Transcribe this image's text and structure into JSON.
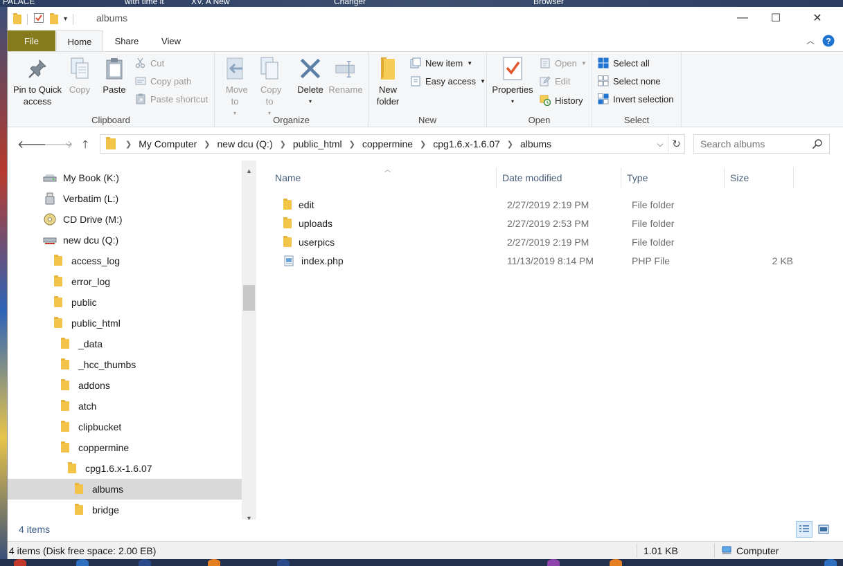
{
  "desktop": {
    "top_labels": [
      "PALACE",
      "with time it",
      "XV. A New",
      "Changer",
      "Browser"
    ]
  },
  "window": {
    "title": "albums",
    "controls": {
      "minimize": "—",
      "maximize": "☐",
      "close": "✕"
    }
  },
  "ribbon_tabs": {
    "file": "File",
    "home": "Home",
    "share": "Share",
    "view": "View"
  },
  "ribbon": {
    "clipboard": {
      "label": "Clipboard",
      "pin": "Pin to Quick access",
      "copy": "Copy",
      "paste": "Paste",
      "cut": "Cut",
      "copy_path": "Copy path",
      "paste_shortcut": "Paste shortcut"
    },
    "organize": {
      "label": "Organize",
      "move_to": "Move to",
      "copy_to": "Copy to",
      "delete": "Delete",
      "rename": "Rename"
    },
    "new": {
      "label": "New",
      "new_folder": "New folder",
      "new_item": "New item",
      "easy_access": "Easy access"
    },
    "open": {
      "label": "Open",
      "properties": "Properties",
      "open": "Open",
      "edit": "Edit",
      "history": "History"
    },
    "select": {
      "label": "Select",
      "select_all": "Select all",
      "select_none": "Select none",
      "invert_selection": "Invert selection"
    }
  },
  "address": {
    "crumbs": [
      "My Computer",
      "new dcu (Q:)",
      "public_html",
      "coppermine",
      "cpg1.6.x-1.6.07",
      "albums"
    ]
  },
  "search": {
    "placeholder": "Search albums"
  },
  "tree": [
    {
      "label": "My Book (K:)",
      "icon": "drive"
    },
    {
      "label": "Verbatim (L:)",
      "icon": "usb"
    },
    {
      "label": "CD Drive (M:)",
      "icon": "cd"
    },
    {
      "label": "new dcu (Q:)",
      "icon": "netdrive"
    },
    {
      "label": "access_log",
      "icon": "folder"
    },
    {
      "label": "error_log",
      "icon": "folder"
    },
    {
      "label": "public",
      "icon": "folder"
    },
    {
      "label": "public_html",
      "icon": "folder"
    },
    {
      "label": "_data",
      "icon": "folder"
    },
    {
      "label": "_hcc_thumbs",
      "icon": "folder"
    },
    {
      "label": "addons",
      "icon": "folder"
    },
    {
      "label": "atch",
      "icon": "folder"
    },
    {
      "label": "clipbucket",
      "icon": "folder"
    },
    {
      "label": "coppermine",
      "icon": "folder"
    },
    {
      "label": "cpg1.6.x-1.6.07",
      "icon": "folder"
    },
    {
      "label": "albums",
      "icon": "folder"
    },
    {
      "label": "bridge",
      "icon": "folder"
    }
  ],
  "columns": {
    "name": "Name",
    "date": "Date modified",
    "type": "Type",
    "size": "Size"
  },
  "files": [
    {
      "name": "edit",
      "date": "2/27/2019 2:19 PM",
      "type": "File folder",
      "size": "",
      "icon": "folder"
    },
    {
      "name": "uploads",
      "date": "2/27/2019 2:53 PM",
      "type": "File folder",
      "size": "",
      "icon": "folder"
    },
    {
      "name": "userpics",
      "date": "2/27/2019 2:19 PM",
      "type": "File folder",
      "size": "",
      "icon": "folder"
    },
    {
      "name": "index.php",
      "date": "11/13/2019 8:14 PM",
      "type": "PHP File",
      "size": "2 KB",
      "icon": "file"
    }
  ],
  "status": {
    "item_count": "4 items",
    "disk_info": "4 items (Disk free space: 2.00 EB)",
    "size": "1.01 KB",
    "location": "Computer"
  }
}
